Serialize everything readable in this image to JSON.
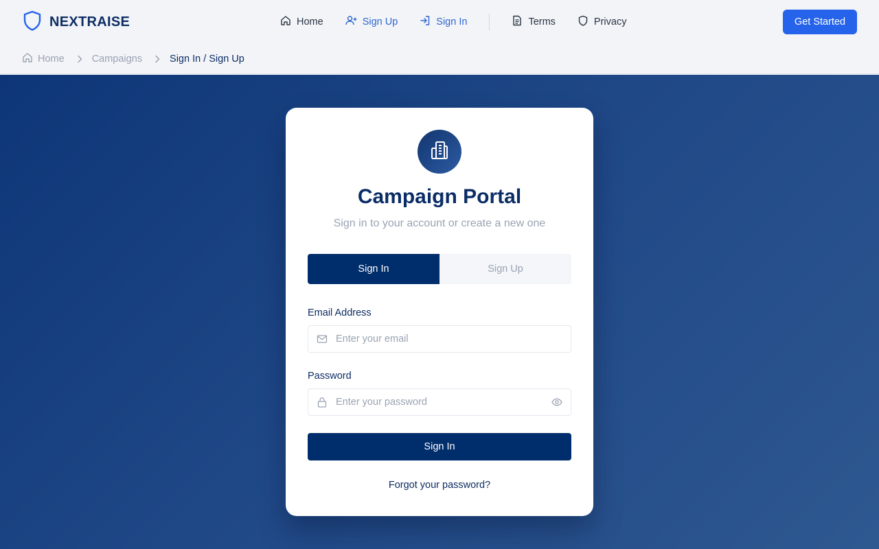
{
  "brand": {
    "name": "NEXTRAISE",
    "color": "#2563eb"
  },
  "nav": {
    "items": [
      {
        "label": "Home",
        "icon": "home-icon"
      },
      {
        "label": "Sign Up",
        "icon": "user-plus-icon"
      },
      {
        "label": "Sign In",
        "icon": "sign-in-icon"
      },
      {
        "label": "Terms",
        "icon": "document-icon"
      },
      {
        "label": "Privacy",
        "icon": "shield-icon"
      }
    ],
    "cta_label": "Get Started"
  },
  "breadcrumb": {
    "items": [
      "Home",
      "Campaigns",
      "Sign In / Sign Up"
    ],
    "home_icon": "home-icon",
    "separator_icon": "chevron-right-icon"
  },
  "card": {
    "icon": "building-icon",
    "title": "Campaign Portal",
    "subtitle": "Sign in to your account or create a new one",
    "tabs": [
      {
        "label": "Sign In",
        "active": true
      },
      {
        "label": "Sign Up",
        "active": false
      }
    ],
    "email": {
      "label": "Email Address",
      "placeholder": "Enter your email",
      "value": "",
      "icon": "mail-icon"
    },
    "password": {
      "label": "Password",
      "placeholder": "Enter your password",
      "value": "",
      "icon": "lock-icon",
      "toggle_icon": "eye-icon"
    },
    "submit_label": "Sign In",
    "forgot_label": "Forgot your password?"
  },
  "colors": {
    "primary": "#002d6b",
    "accent": "#2563eb",
    "link_accent": "#2f67cf",
    "hero_gradient_start": "#0d3678",
    "hero_gradient_end": "#2e5890",
    "muted_text": "#9aa3b2"
  }
}
